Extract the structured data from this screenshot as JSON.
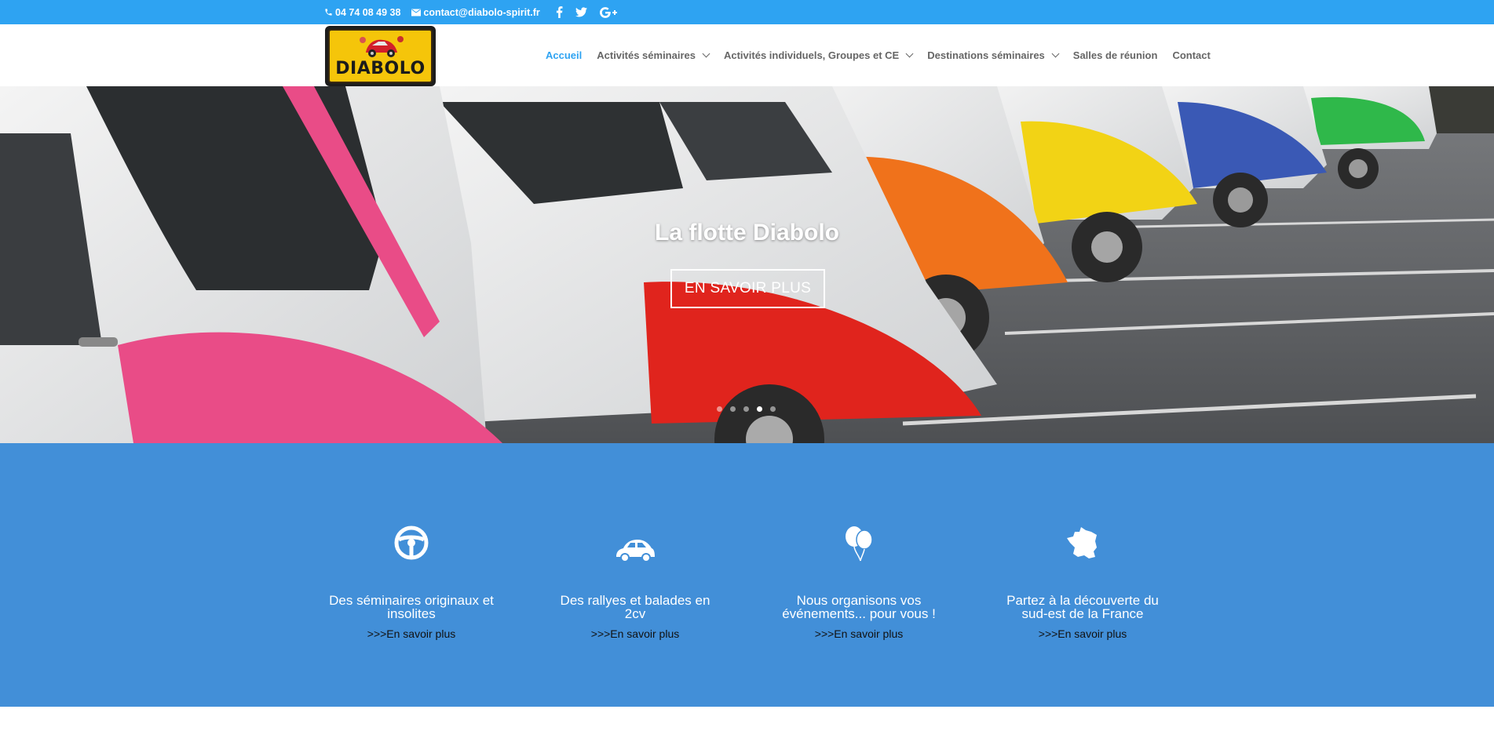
{
  "topbar": {
    "phone": "04 74 08 49 38",
    "email": "contact@diabolo-spirit.fr",
    "social": [
      "facebook-icon",
      "twitter-icon",
      "google-plus-icon"
    ],
    "color": "#2ea3f2"
  },
  "logo": {
    "text": "DIABOLO"
  },
  "nav": {
    "items": [
      {
        "label": "Accueil",
        "active": true
      },
      {
        "label": "Activités séminaires",
        "dropdown": true
      },
      {
        "label": "Activités individuels, Groupes et CE",
        "dropdown": true
      },
      {
        "label": "Destinations séminaires",
        "dropdown": true
      },
      {
        "label": "Salles de réunion"
      },
      {
        "label": "Contact"
      }
    ],
    "active_color": "#2ea3f2"
  },
  "hero": {
    "title": "La flotte Diabolo",
    "button": "EN SAVOIR PLUS",
    "slide_count": 5,
    "active_slide": 4
  },
  "features": {
    "background": "#428fd8",
    "items": [
      {
        "icon": "steering-wheel-icon",
        "title_line1": "Des séminaires originaux et",
        "title_line2": "insolites",
        "link": ">>>En savoir plus"
      },
      {
        "icon": "car-icon",
        "title_line1": "Des rallyes et balades en",
        "title_line2": "2cv",
        "link": ">>>En savoir plus"
      },
      {
        "icon": "balloons-icon",
        "title_line1": "Nous organisons vos",
        "title_line2": "événements... pour vous !",
        "link": ">>>En savoir plus"
      },
      {
        "icon": "france-map-icon",
        "title_line1": "Partez à la découverte du",
        "title_line2": "sud-est de la France",
        "link": ">>>En savoir plus"
      }
    ]
  }
}
